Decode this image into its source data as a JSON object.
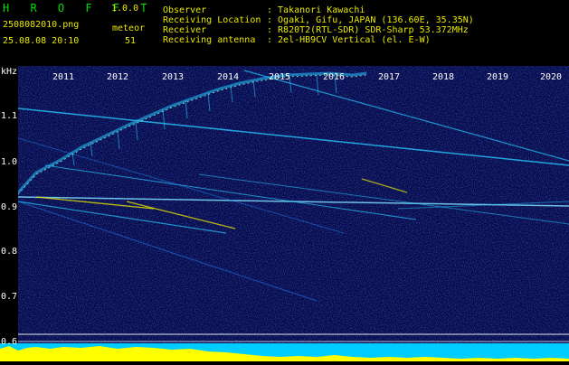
{
  "header": {
    "app_title": "H R O F F T",
    "version": "1.0.0",
    "filename": "2508082010.png",
    "datetime": "25.08.08 20:10",
    "meteor_label": "meteor",
    "meteor_count": "51",
    "info_labels": [
      "Observer",
      "Receiving Location",
      "Receiver",
      "Receiving antenna"
    ],
    "info_values": [
      ": Takanori Kawachi",
      ": Ogaki, Gifu, JAPAN (136.60E, 35.35N)",
      ": R820T2(RTL-SDR) SDR-Sharp 53.372MHz",
      ": 2el-HB9CV Vertical (el. E-W)"
    ]
  },
  "axis": {
    "unit": "kHz",
    "ticks": [
      "1.1",
      "1.0",
      "0.9",
      "0.8",
      "0.7",
      "0.6"
    ],
    "years": [
      "2011",
      "2012",
      "2013",
      "2014",
      "2015",
      "2016",
      "2017",
      "2018",
      "2019",
      "2020"
    ]
  },
  "colors": {
    "background": "#050a4a",
    "header_green": "#00e000",
    "header_yellow": "#e8e800",
    "signal_cyan": "#28c8ff",
    "signal_yellow": "#e8e800",
    "strip_yellow": "#ffff00",
    "strip_cyan": "#00ccff"
  }
}
